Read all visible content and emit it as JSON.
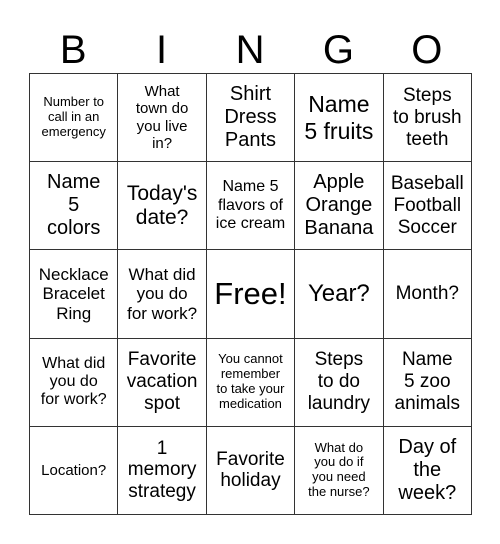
{
  "header": [
    "B",
    "I",
    "N",
    "G",
    "O"
  ],
  "grid": [
    [
      "Number to\ncall in an\nemergency",
      "What\ntown do\nyou live\nin?",
      "Shirt\nDress\nPants",
      "Name\n5 fruits",
      "Steps\nto brush\nteeth"
    ],
    [
      "Name\n5\ncolors",
      "Today's\ndate?",
      "Name 5\nflavors of\nice cream",
      "Apple\nOrange\nBanana",
      "Baseball\nFootball\nSoccer"
    ],
    [
      "Necklace\nBracelet\nRing",
      "What did\nyou do\nfor work?",
      "Free!",
      "Year?",
      "Month?"
    ],
    [
      "What did\nyou do\nfor work?",
      "Favorite\nvacation\nspot",
      "You cannot\nremember\nto take your\nmedication",
      "Steps\nto do\nlaundry",
      "Name\n5 zoo\nanimals"
    ],
    [
      "Location?",
      "1\nmemory\nstrategy",
      "Favorite\nholiday",
      "What do\nyou do if\nyou need\nthe nurse?",
      "Day of\nthe\nweek?"
    ]
  ]
}
